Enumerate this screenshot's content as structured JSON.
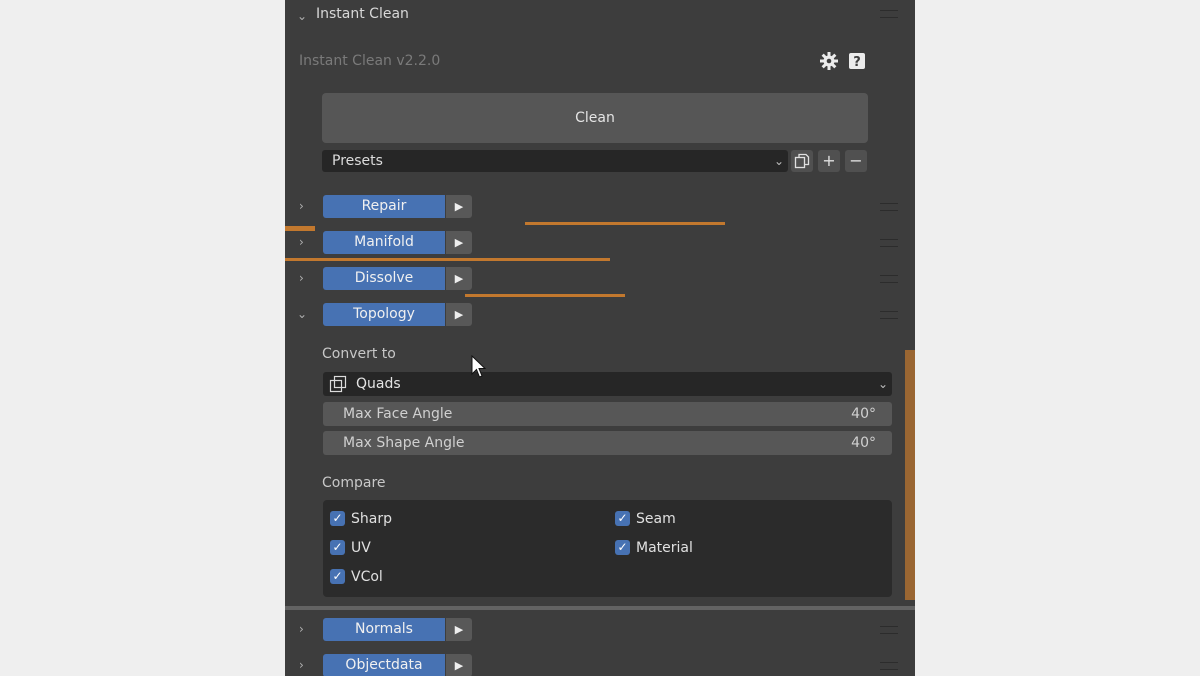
{
  "panel": {
    "header_title": "Instant Clean",
    "version_text": "Instant Clean v2.2.0",
    "clean_button": "Clean",
    "presets_label": "Presets",
    "preset_add": "+",
    "preset_remove": "−"
  },
  "sections": [
    {
      "label": "Repair",
      "expanded": false
    },
    {
      "label": "Manifold",
      "expanded": false
    },
    {
      "label": "Dissolve",
      "expanded": false
    },
    {
      "label": "Topology",
      "expanded": true
    },
    {
      "label": "Normals",
      "expanded": false
    },
    {
      "label": "Objectdata",
      "expanded": false
    }
  ],
  "topology": {
    "convert_to_label": "Convert to",
    "convert_to_value": "Quads",
    "max_face_angle": {
      "label": "Max Face Angle",
      "value": "40°"
    },
    "max_shape_angle": {
      "label": "Max Shape Angle",
      "value": "40°"
    },
    "compare_label": "Compare",
    "compare_options": [
      {
        "label": "Sharp",
        "checked": true
      },
      {
        "label": "Seam",
        "checked": true
      },
      {
        "label": "UV",
        "checked": true
      },
      {
        "label": "Material",
        "checked": true
      },
      {
        "label": "VCol",
        "checked": true
      }
    ]
  },
  "icons": {
    "settings": "gear-icon",
    "help": "help-icon",
    "copy": "copy-preset-icon",
    "play": "play-icon",
    "chevron_right": "chevron-right-icon",
    "chevron_down": "chevron-down-icon",
    "quads": "quads-icon",
    "cursor": "mouse-cursor-icon"
  },
  "colors": {
    "accent": "#4772b3",
    "panel_bg": "#3d3d3d",
    "page_bg": "#efefef"
  }
}
